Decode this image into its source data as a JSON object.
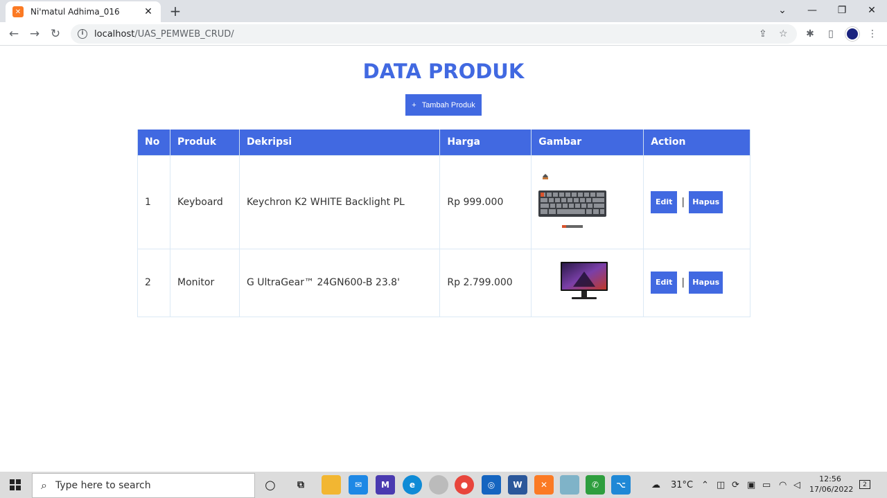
{
  "browser": {
    "tab_title": "Ni'matul Adhima_016",
    "tab_close": "✕",
    "new_tab": "+",
    "url_host": "localhost",
    "url_path": "/UAS_PEMWEB_CRUD/"
  },
  "page": {
    "title": "DATA PRODUK",
    "add_button": "Tambah Produk",
    "add_icon": "+"
  },
  "table": {
    "headers": [
      "No",
      "Produk",
      "Dekripsi",
      "Harga",
      "Gambar",
      "Action"
    ],
    "rows": [
      {
        "no": "1",
        "produk": "Keyboard",
        "deskripsi": "Keychron K2 WHITE Backlight PL",
        "harga": "Rp 999.000",
        "gambar": "keyboard-image"
      },
      {
        "no": "2",
        "produk": "Monitor",
        "deskripsi": "G UltraGear™ 24GN600-B 23.8'",
        "harga": "Rp 2.799.000",
        "gambar": "monitor-image"
      }
    ],
    "edit_label": "Edit",
    "hapus_label": "Hapus",
    "separator": "|"
  },
  "taskbar": {
    "search_placeholder": "Type here to search",
    "weather": "31°C",
    "time": "12:56",
    "date": "17/06/2022",
    "notification_count": "2"
  },
  "colors": {
    "accent": "#4169e1",
    "tab_bar": "#dee1e6",
    "taskbar": "#dcdcdc"
  }
}
